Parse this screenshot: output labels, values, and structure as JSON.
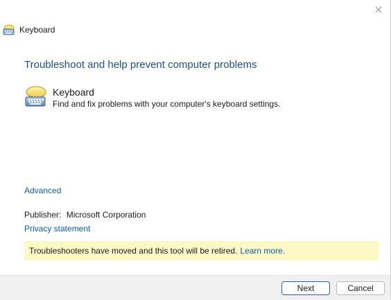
{
  "window": {
    "title": "Keyboard",
    "close_icon": "close-icon",
    "title_icon": "keyboard-help-icon"
  },
  "main": {
    "heading": "Troubleshoot and help prevent computer problems",
    "item": {
      "name": "Keyboard",
      "description": "Find and fix problems with your computer's keyboard settings.",
      "icon": "keyboard-help-icon"
    },
    "advanced_link": "Advanced",
    "publisher_label": "Publisher:",
    "publisher_value": "Microsoft Corporation",
    "privacy_link": "Privacy statement",
    "notice": {
      "text": "Troubleshooters have moved and this tool will be retired.",
      "link": "Learn more."
    }
  },
  "footer": {
    "next_label": "Next",
    "cancel_label": "Cancel"
  },
  "colors": {
    "heading": "#1e4e8c",
    "link": "#0b5cad",
    "notice_bg": "#fdf9c7",
    "footer_bg": "#f0f0f0",
    "primary_border": "#2d5ea8"
  }
}
